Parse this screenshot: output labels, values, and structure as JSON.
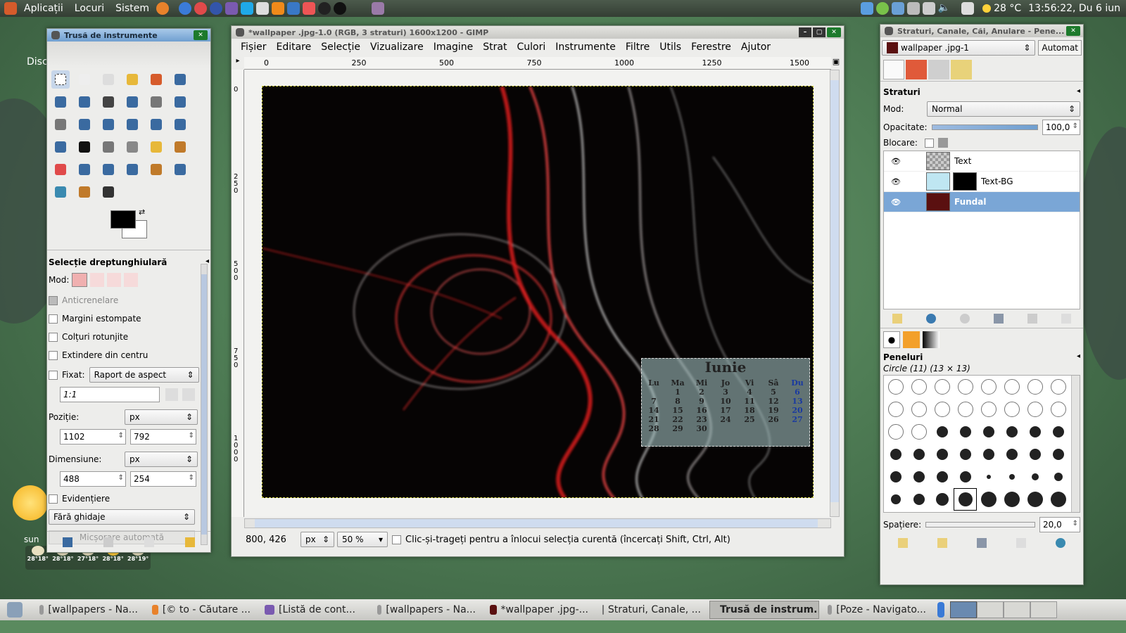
{
  "panel": {
    "menus": [
      "Aplicații",
      "Locuri",
      "Sistem"
    ],
    "weather": "28 °C",
    "clock": "13:56:22, Du  6 iun"
  },
  "desktop": {
    "partial_label": "Disc",
    "weather_widget_day": "sun",
    "forecast": [
      "28°18°",
      "28°18°",
      "27°18°",
      "28°18°",
      "28°19°"
    ]
  },
  "toolbox": {
    "title": "Trusă de instrumente",
    "options_title": "Selecție dreptunghiulară",
    "mode_label": "Mod:",
    "antialias": "Anticrenelare",
    "feather": "Margini estompate",
    "rounded": "Colțuri rotunjite",
    "expand": "Extindere din centru",
    "fixed_label": "Fixat:",
    "fixed_value": "Raport de aspect",
    "aspect": "1:1",
    "position_label": "Poziție:",
    "position_unit": "px",
    "pos_x": "1102",
    "pos_y": "792",
    "size_label": "Dimensiune:",
    "size_unit": "px",
    "size_w": "488",
    "size_h": "254",
    "highlight": "Evidențiere",
    "guides": "Fără ghidaje",
    "autoshrink": "Micșorare automată"
  },
  "gimp": {
    "title": "*wallpaper .jpg-1.0 (RGB, 3 straturi) 1600x1200 - GIMP",
    "menu": [
      "Fișier",
      "Editare",
      "Selecție",
      "Vizualizare",
      "Imagine",
      "Strat",
      "Culori",
      "Instrumente",
      "Filtre",
      "Utils",
      "Ferestre",
      "Ajutor"
    ],
    "ruler": [
      "0",
      "250",
      "500",
      "750",
      "1000",
      "1250",
      "1500"
    ],
    "vruler": [
      "0",
      "2 5 0",
      "5 0 0",
      "7 5 0",
      "1 0 0 0"
    ],
    "coords": "800, 426",
    "unit": "px",
    "zoom": "50 %",
    "status": "Clic-și-trageți pentru a înlocui selecția curentă (încercați Shift, Ctrl, Alt)"
  },
  "calendar": {
    "month": "Iunie",
    "days": [
      "Lu",
      "Ma",
      "Mi",
      "Jo",
      "Vi",
      "Sâ",
      "Du"
    ],
    "weeks": [
      [
        "",
        "1",
        "2",
        "3",
        "4",
        "5",
        "6"
      ],
      [
        "7",
        "8",
        "9",
        "10",
        "11",
        "12",
        "13"
      ],
      [
        "14",
        "15",
        "16",
        "17",
        "18",
        "19",
        "20"
      ],
      [
        "21",
        "22",
        "23",
        "24",
        "25",
        "26",
        "27"
      ],
      [
        "28",
        "29",
        "30",
        "",
        "",
        "",
        ""
      ]
    ]
  },
  "layers": {
    "title": "Straturi, Canale, Căi, Anulare - Pene...",
    "image": "wallpaper .jpg-1",
    "auto": "Automat",
    "section": "Straturi",
    "mode_label": "Mod:",
    "mode": "Normal",
    "opacity_label": "Opacitate:",
    "opacity": "100,0",
    "lock_label": "Blocare:",
    "items": [
      "Text",
      "Text-BG",
      "Fundal"
    ],
    "brushes_title": "Peneluri",
    "brush_name": "Circle (11) (13 × 13)",
    "spacing_label": "Spațiere:",
    "spacing": "20,0"
  },
  "taskbar": {
    "tasks": [
      "[wallpapers - Na...",
      "[© to - Căutare ...",
      "[Listă de cont...",
      "[wallpapers - Na...",
      "*wallpaper .jpg-...",
      "Straturi, Canale, ...",
      "Trusă de instrum...",
      "[Poze - Navigato..."
    ]
  },
  "colors": {
    "accent": "#6f9fd0",
    "selected_row": "#7aa6d6",
    "title_green": "#1d7a2c"
  }
}
